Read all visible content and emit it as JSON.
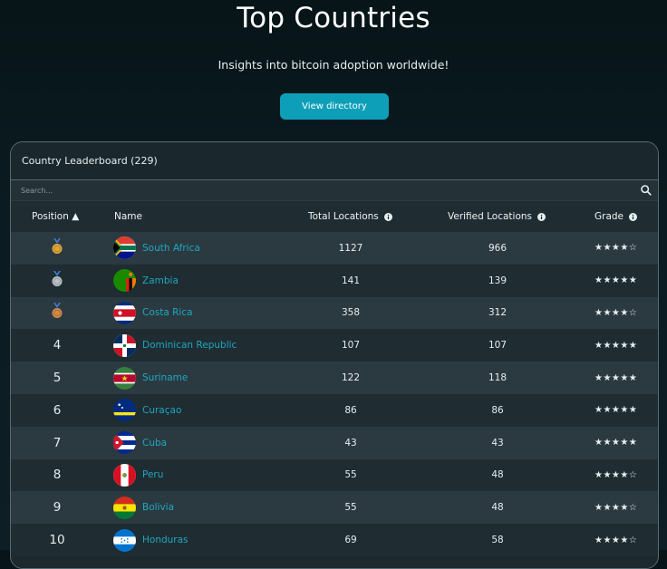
{
  "title": "Top Countries",
  "subtitle": "Insights into bitcoin adoption worldwide!",
  "view_directory_label": "View directory",
  "leaderboard": {
    "title": "Country Leaderboard (229)",
    "search_placeholder": "Search...",
    "columns": {
      "position": "Position ▲",
      "name": "Name",
      "total": "Total Locations",
      "verified": "Verified Locations",
      "grade": "Grade"
    },
    "rows": [
      {
        "position": "",
        "medal": "gold",
        "name": "South Africa",
        "flag": "za-flag-icon",
        "total": "1127",
        "verified": "966",
        "grade": "★★★★☆"
      },
      {
        "position": "",
        "medal": "silver",
        "name": "Zambia",
        "flag": "zm-flag-icon",
        "total": "141",
        "verified": "139",
        "grade": "★★★★★"
      },
      {
        "position": "",
        "medal": "bronze",
        "name": "Costa Rica",
        "flag": "cr-flag-icon",
        "total": "358",
        "verified": "312",
        "grade": "★★★★☆"
      },
      {
        "position": "4",
        "medal": "",
        "name": "Dominican Republic",
        "flag": "do-flag-icon",
        "total": "107",
        "verified": "107",
        "grade": "★★★★★"
      },
      {
        "position": "5",
        "medal": "",
        "name": "Suriname",
        "flag": "sr-flag-icon",
        "total": "122",
        "verified": "118",
        "grade": "★★★★★"
      },
      {
        "position": "6",
        "medal": "",
        "name": "Curaçao",
        "flag": "cw-flag-icon",
        "total": "86",
        "verified": "86",
        "grade": "★★★★★"
      },
      {
        "position": "7",
        "medal": "",
        "name": "Cuba",
        "flag": "cu-flag-icon",
        "total": "43",
        "verified": "43",
        "grade": "★★★★★"
      },
      {
        "position": "8",
        "medal": "",
        "name": "Peru",
        "flag": "pe-flag-icon",
        "total": "55",
        "verified": "48",
        "grade": "★★★★☆"
      },
      {
        "position": "9",
        "medal": "",
        "name": "Bolivia",
        "flag": "bo-flag-icon",
        "total": "55",
        "verified": "48",
        "grade": "★★★★☆"
      },
      {
        "position": "10",
        "medal": "",
        "name": "Honduras",
        "flag": "hn-flag-icon",
        "total": "69",
        "verified": "58",
        "grade": "★★★★☆"
      }
    ]
  },
  "colors": {
    "accent": "#0e9fb8",
    "link": "#1fa7c2",
    "gold": "#e0a53a",
    "silver": "#b9c2c6",
    "bronze": "#d08a4a"
  }
}
